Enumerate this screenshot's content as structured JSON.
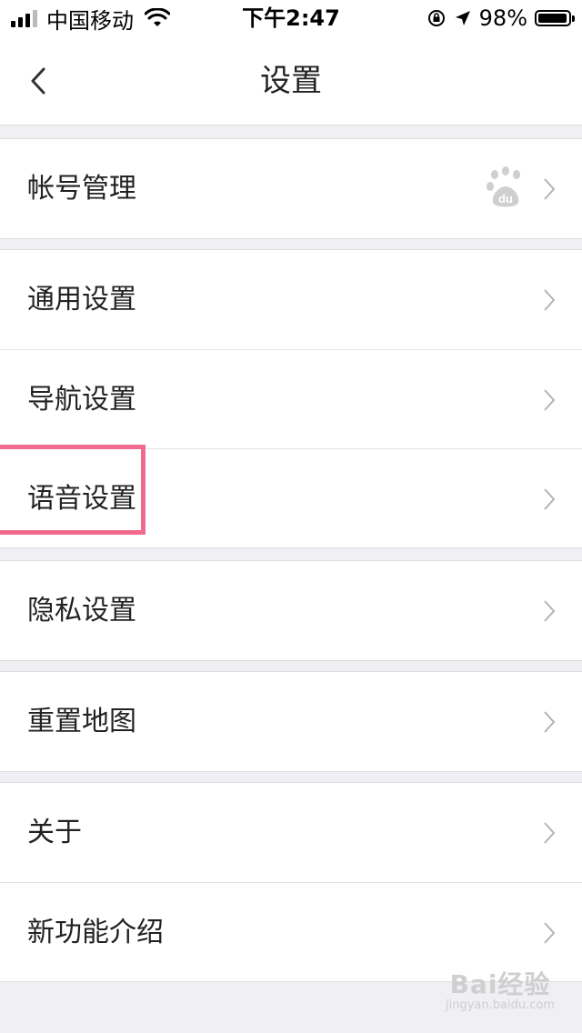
{
  "status_bar": {
    "carrier": "中国移动",
    "time": "下午2:47",
    "battery_percent": "98%",
    "battery_level": 0.98
  },
  "header": {
    "title": "设置",
    "back_icon": "chevron-left-icon"
  },
  "groups": [
    {
      "items": [
        {
          "label": "帐号管理",
          "icon": "baidu-paw-icon"
        }
      ]
    },
    {
      "items": [
        {
          "label": "通用设置"
        },
        {
          "label": "导航设置"
        },
        {
          "label": "语音设置",
          "highlighted": true
        }
      ]
    },
    {
      "items": [
        {
          "label": "隐私设置"
        }
      ]
    },
    {
      "items": [
        {
          "label": "重置地图"
        }
      ]
    },
    {
      "items": [
        {
          "label": "关于"
        },
        {
          "label": "新功能介绍"
        }
      ]
    }
  ],
  "colors": {
    "background": "#efeff4",
    "highlight": "#f06a8e",
    "chevron": "#b3b3b3"
  },
  "watermark": {
    "text": "Bai经验",
    "url": "jingyan.baidu.com"
  }
}
